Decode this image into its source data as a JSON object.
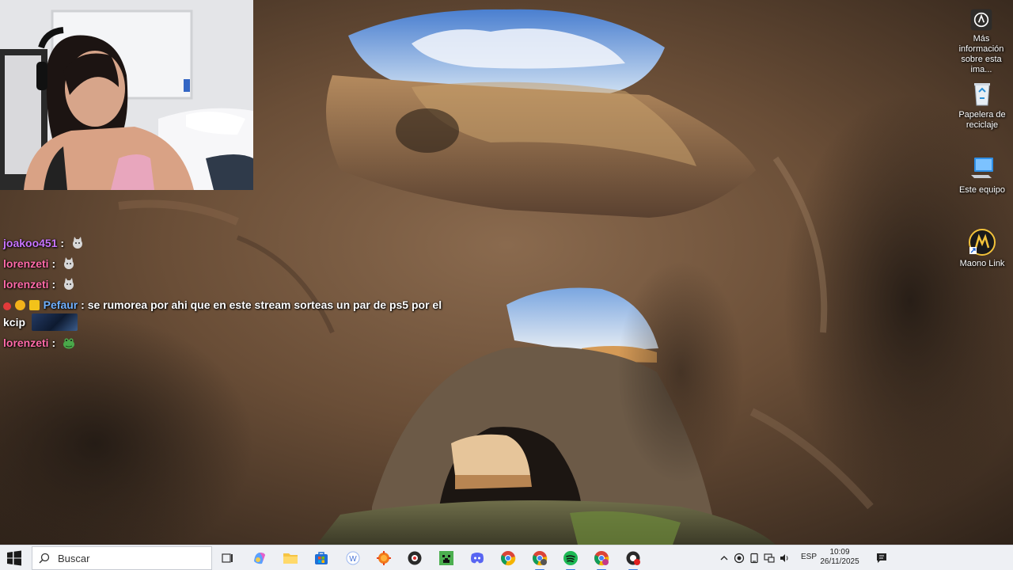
{
  "chat": {
    "messages": [
      {
        "user": "joakoo451",
        "separator": ":",
        "emote": "cat-emote"
      },
      {
        "user": "lorenzeti",
        "separator": ":",
        "emote": "cat-emote"
      },
      {
        "user": "lorenzeti",
        "separator": ":",
        "emote": "cat-emote"
      },
      {
        "user": "Pefaur",
        "separator": ":",
        "text": "se rumorea por ahi que en este stream sorteas un par de ps5 por el",
        "text_cont": "kcip",
        "emote": "kcip-image"
      },
      {
        "user": "lorenzeti",
        "separator": ":",
        "emote": "frog-emote"
      }
    ],
    "colors": {
      "joakoo451": "#c874ff",
      "lorenzeti": "#ff6aa8",
      "Pefaur": "#6fb0ff"
    }
  },
  "desktop": {
    "icons": [
      {
        "name": "info-icon",
        "label": "Más información sobre esta ima..."
      },
      {
        "name": "recycle-bin-icon",
        "label": "Papelera de reciclaje"
      },
      {
        "name": "this-pc-icon",
        "label": "Este equipo"
      },
      {
        "name": "maono-link-icon",
        "label": "Maono Link"
      }
    ]
  },
  "taskbar": {
    "search_placeholder": "Buscar",
    "apps": [
      "task-view-icon",
      "copilot-icon",
      "file-explorer-icon",
      "store-icon",
      "wps-icon",
      "orange-app-icon",
      "obs-icon",
      "minecraft-icon",
      "discord-icon",
      "chrome-icon",
      "chrome-profile-icon",
      "spotify-icon",
      "chrome-profile-2-icon",
      "obs-record-icon"
    ],
    "language": "ESP",
    "time": "10:09",
    "date": "26/11/2025"
  },
  "colors": {
    "taskbar_bg": "#eef0f4",
    "accent": "#3b7be0"
  }
}
